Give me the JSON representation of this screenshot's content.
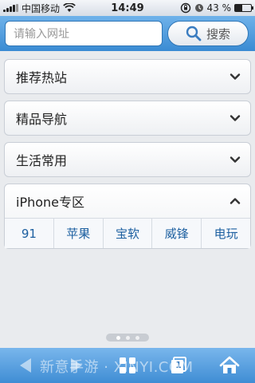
{
  "status_bar": {
    "carrier": "中国移动",
    "time": "14:49",
    "battery": "43 %",
    "battery_level": 0.43
  },
  "header": {
    "url_placeholder": "请输入网址",
    "search_label": "搜索"
  },
  "sections": [
    {
      "title": "推荐热站",
      "expanded": false
    },
    {
      "title": "精品导航",
      "expanded": false
    },
    {
      "title": "生活常用",
      "expanded": false
    },
    {
      "title": "iPhone专区",
      "expanded": true,
      "links": [
        "91",
        "苹果",
        "宝软",
        "威锋",
        "电玩"
      ]
    }
  ],
  "pager": {
    "pages": 3,
    "current": 1
  },
  "toolbar": {
    "tab_count": "1",
    "watermark": "新意手游 · XINYI.COM"
  },
  "colors": {
    "accent": "#3a8bd3",
    "link": "#1c5fa0"
  }
}
